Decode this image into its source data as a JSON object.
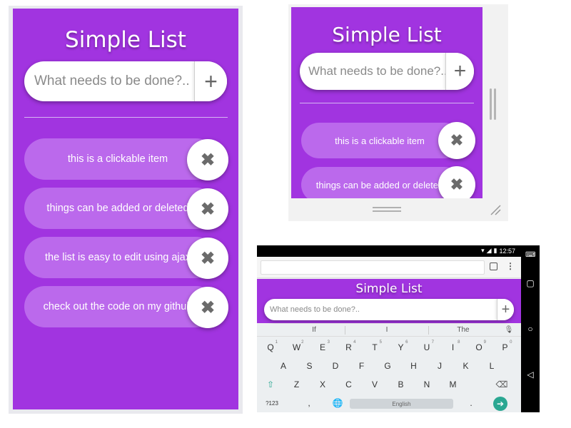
{
  "app": {
    "title": "Simple List",
    "input_placeholder": "What needs to be done?..",
    "add_label": "+",
    "delete_label": "✖"
  },
  "panel_large": {
    "items": [
      "this is a clickable item",
      "things can be added or deleted",
      "the list is easy to edit using ajax",
      "check out the code on my github"
    ]
  },
  "panel_small": {
    "input_placeholder": "What needs to be done?..",
    "items": [
      "this is a clickable item",
      "things can be added or deleted"
    ]
  },
  "panel_mobile": {
    "status_time": "12:57",
    "input_placeholder": "What needs to be done?..",
    "suggestions": [
      "If",
      "I",
      "The"
    ],
    "keyboard_rows": [
      [
        {
          "k": "Q",
          "n": "1"
        },
        {
          "k": "W",
          "n": "2"
        },
        {
          "k": "E",
          "n": "3"
        },
        {
          "k": "R",
          "n": "4"
        },
        {
          "k": "T",
          "n": "5"
        },
        {
          "k": "Y",
          "n": "6"
        },
        {
          "k": "U",
          "n": "7"
        },
        {
          "k": "I",
          "n": "8"
        },
        {
          "k": "O",
          "n": "9"
        },
        {
          "k": "P",
          "n": "0"
        }
      ],
      [
        {
          "k": "A"
        },
        {
          "k": "S"
        },
        {
          "k": "D"
        },
        {
          "k": "F"
        },
        {
          "k": "G"
        },
        {
          "k": "H"
        },
        {
          "k": "J"
        },
        {
          "k": "K"
        },
        {
          "k": "L"
        }
      ],
      [
        {
          "k": "⇧"
        },
        {
          "k": "Z"
        },
        {
          "k": "X"
        },
        {
          "k": "C"
        },
        {
          "k": "V"
        },
        {
          "k": "B"
        },
        {
          "k": "N"
        },
        {
          "k": "M"
        },
        {
          "k": "⌫"
        }
      ],
      [
        {
          "k": "?123"
        },
        {
          "k": ","
        },
        {
          "k": "🌐"
        }
      ]
    ],
    "space_label": "English",
    "period_label": ".",
    "enter_label": "➔"
  },
  "colors": {
    "app_bg": "#a134e0",
    "item_bg": "#bb69ec",
    "enter_key": "#2aa792"
  }
}
